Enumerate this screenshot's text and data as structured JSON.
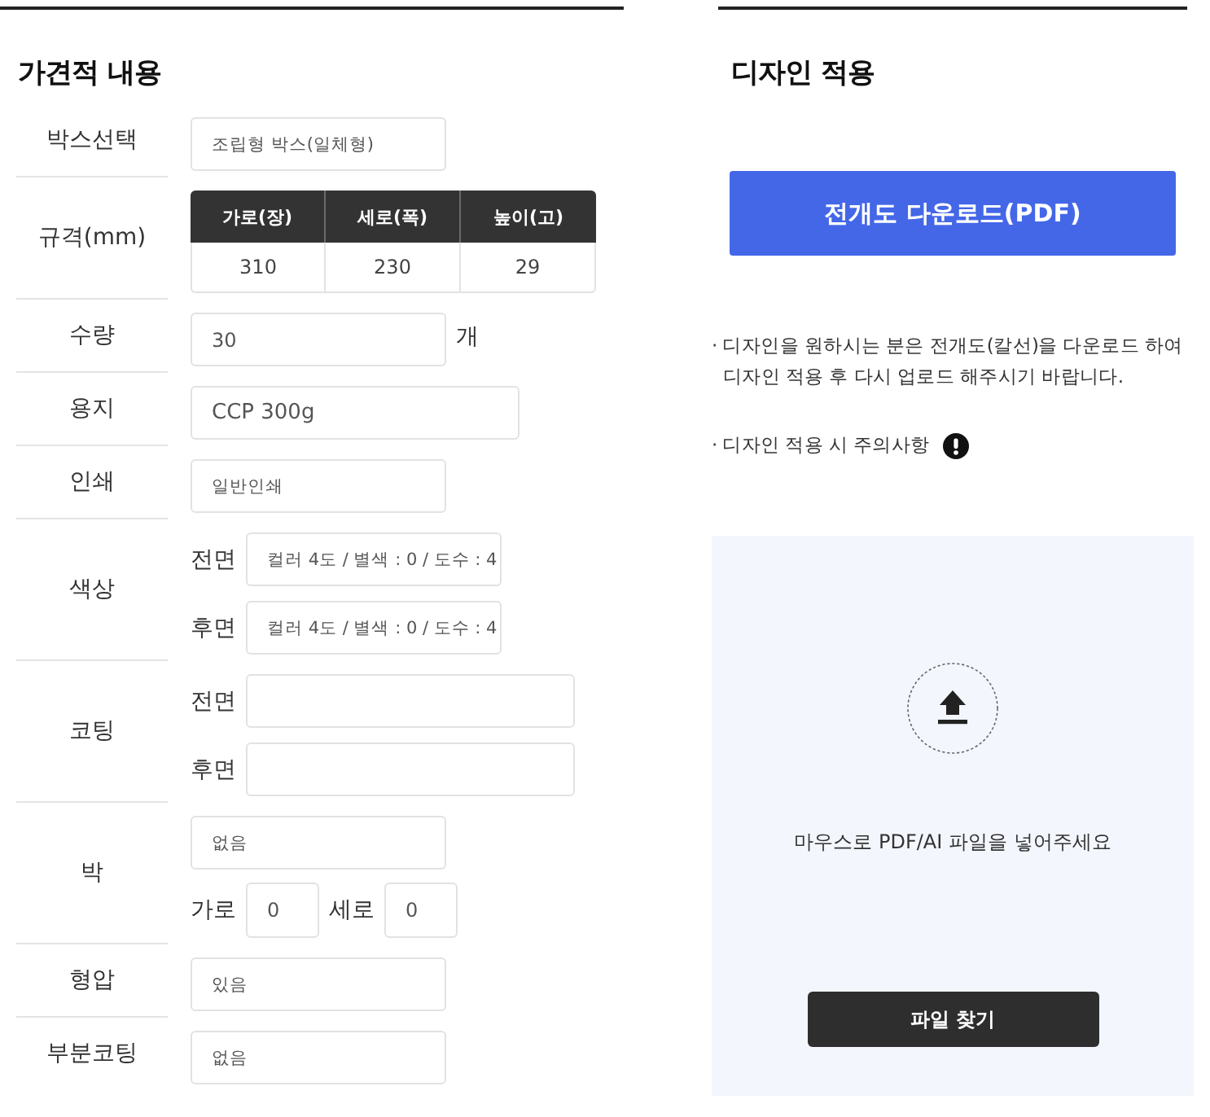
{
  "estimate": {
    "title": "가견적 내용",
    "rows": [
      {
        "label": "박스선택",
        "kind": "single",
        "field": {
          "kind": "select",
          "value": "조립형 박스(일체형)"
        }
      },
      {
        "label": "규격(mm)",
        "kind": "size_table",
        "columns": [
          "가로(장)",
          "세로(폭)",
          "높이(고)"
        ],
        "values": [
          "310",
          "230",
          "29"
        ]
      },
      {
        "label": "수량",
        "kind": "single",
        "field": {
          "kind": "text",
          "value": "30"
        },
        "unit": "개"
      },
      {
        "label": "용지",
        "kind": "single",
        "field": {
          "kind": "wide",
          "value": "CCP 300g"
        }
      },
      {
        "label": "인쇄",
        "kind": "single",
        "field": {
          "kind": "select",
          "value": "일반인쇄"
        }
      },
      {
        "label": "색상",
        "kind": "sided",
        "sides": [
          {
            "label": "전면",
            "field": {
              "kind": "select",
              "value": "컬러 4도 / 별색 : 0 / 도수 : 4"
            }
          },
          {
            "label": "후면",
            "field": {
              "kind": "select",
              "value": "컬러 4도 / 별색 : 0 / 도수 : 4"
            }
          }
        ]
      },
      {
        "label": "코팅",
        "kind": "sided",
        "sides": [
          {
            "label": "전면",
            "field": {
              "kind": "wide"
            }
          },
          {
            "label": "후면",
            "field": {
              "kind": "wide"
            }
          }
        ]
      },
      {
        "label": "박",
        "kind": "foil",
        "field": {
          "kind": "select",
          "value": "없음"
        },
        "dims": [
          {
            "label": "가로",
            "field": {
              "kind": "small",
              "value": "0"
            }
          },
          {
            "label": "세로",
            "field": {
              "kind": "small",
              "value": "0"
            }
          }
        ]
      },
      {
        "label": "형압",
        "kind": "single",
        "field": {
          "kind": "select",
          "value": "있음"
        }
      },
      {
        "label": "부분코팅",
        "kind": "single",
        "field": {
          "kind": "select",
          "value": "없음"
        }
      }
    ]
  },
  "design": {
    "title": "디자인 적용",
    "download_button": "전개도 다운로드(PDF)",
    "notes": [
      {
        "kind": "plain",
        "text": "· 디자인을 원하시는 분은 전개도(칼선)을 다운로드 하여 디자인 적용 후 다시 업로드 해주시기 바랍니다."
      },
      {
        "kind": "caution",
        "text": "· 디자인 적용 시 주의사항"
      }
    ],
    "upload": {
      "hint": "마우스로 PDF/AI 파일을 넣어주세요",
      "button": "파일 찾기"
    }
  }
}
